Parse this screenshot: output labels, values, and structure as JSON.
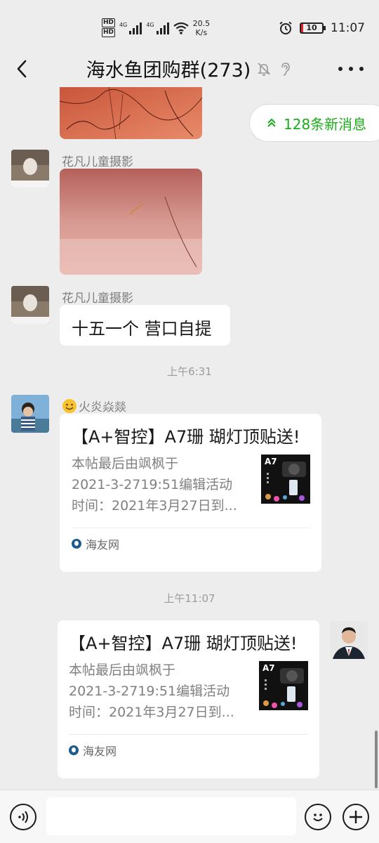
{
  "status_bar": {
    "hd1": "HD",
    "hd2": "HD",
    "network1": "4G",
    "network2": "4G",
    "speed_value": "20.5",
    "speed_unit": "K/s",
    "battery": "10",
    "time": "11:07",
    "icons": [
      "signal-icon",
      "wifi-icon",
      "alarm-icon",
      "battery-icon"
    ]
  },
  "header": {
    "title": "海水鱼团购群(273)",
    "icons": [
      "back-icon",
      "mute-icon",
      "ear-icon",
      "more-icon"
    ]
  },
  "new_messages": "128条新消息",
  "messages": [
    {
      "sender": "花凡儿童摄影",
      "type": "image"
    },
    {
      "sender": "花凡儿童摄影",
      "text": "十五一个 营口自提"
    },
    {
      "time": "上午6:31"
    },
    {
      "sender": "火炎焱燚",
      "type": "link-card",
      "title": "【A+智控】A7珊 瑚灯顶贴送!",
      "desc_lines": [
        "本帖最后由飒枫于",
        "2021-3-2719:51编辑活动",
        "时间：2021年3月27日到..."
      ],
      "thumb_label": "A7",
      "source": "海友网"
    },
    {
      "time": "上午11:07"
    },
    {
      "sender": "me",
      "type": "link-card",
      "title": "【A+智控】A7珊 瑚灯顶贴送!",
      "desc_lines": [
        "本帖最后由飒枫于",
        "2021-3-2719:51编辑活动",
        "时间：2021年3月27日到..."
      ],
      "thumb_label": "A7",
      "source": "海友网"
    }
  ],
  "input_bar": {
    "icons": [
      "voice-icon",
      "emoji-icon",
      "plus-icon"
    ],
    "value": ""
  },
  "colors": {
    "background": "#ededed",
    "accent_green": "#1aad19",
    "bubble": "#ffffff"
  }
}
